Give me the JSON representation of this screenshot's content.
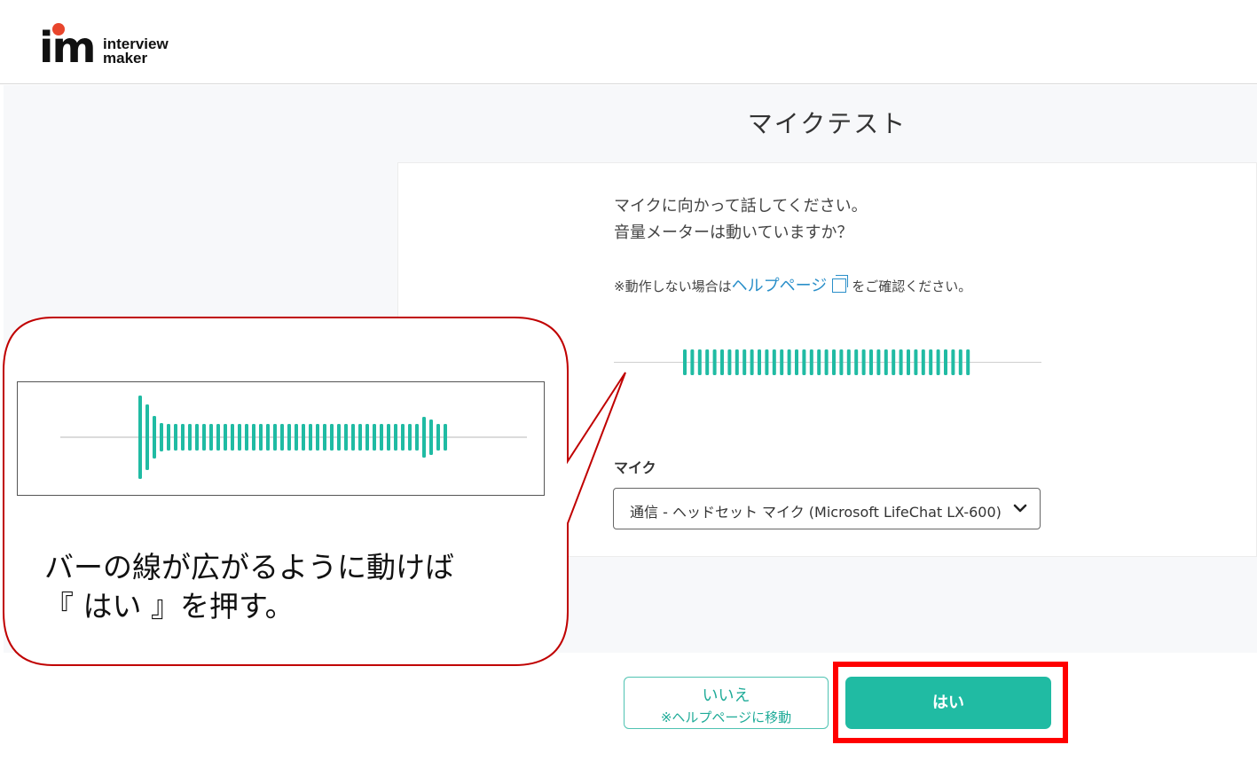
{
  "header": {
    "logo_mark": "im",
    "logo_text_line1": "interview",
    "logo_text_line2": "maker"
  },
  "page": {
    "title": "マイクテスト"
  },
  "card": {
    "instruction_line1": "マイクに向かって話してください。",
    "instruction_line2": "音量メーターは動いていますか？",
    "help_prefix": "※動作しない場合は",
    "help_link": "ヘルプページ",
    "help_suffix": "をご確認ください。",
    "mic_label": "マイク",
    "mic_selected": "通信 - ヘッドセット マイク (Microsoft LifeChat LX-600)"
  },
  "buttons": {
    "no_line1": "いいえ",
    "no_line2": "※ヘルプページに移動",
    "yes": "はい"
  },
  "callout": {
    "line1": "バーの線が広がるように動けば",
    "line2": "『 はい 』を押す。"
  },
  "colors": {
    "accent": "#20bba3",
    "link": "#2a8fc9",
    "highlight": "#ff0000",
    "callout_border": "#c00000"
  }
}
